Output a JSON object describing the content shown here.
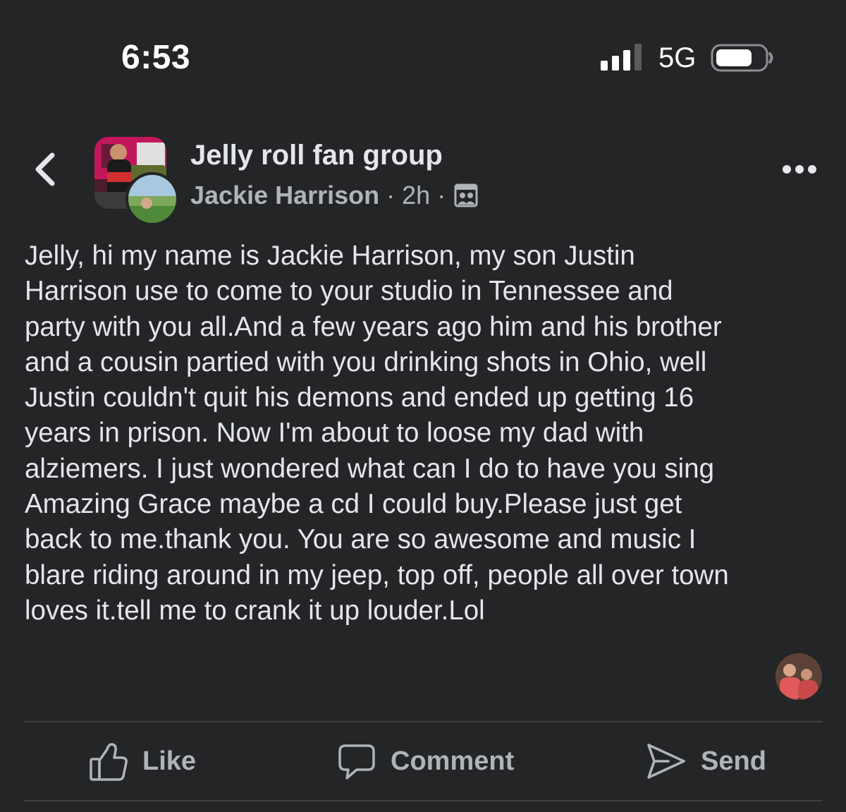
{
  "status_bar": {
    "time": "6:53",
    "network": "5G",
    "signal_level": 3,
    "signal_max": 4
  },
  "header": {
    "back_icon": "chevron-left-icon",
    "group_name": "Jelly roll fan group",
    "author": "Jackie Harrison",
    "separator": "·",
    "time_ago": "2h",
    "privacy_icon": "group-members-icon",
    "more_icon": "more-horizontal-icon"
  },
  "post": {
    "text": "Jelly, hi my name is Jackie Harrison, my son Justin\nHarrison use to come to your studio in Tennessee and\nparty with you all.And a few years ago him and his brother\nand a cousin partied with you drinking shots in Ohio, well\nJustin couldn't quit his demons and ended up getting 16\nyears in prison. Now I'm about to loose my dad with\nalziemers. I just wondered what can I do to have you sing\nAmazing Grace maybe a cd I could buy.Please just get\nback to me.thank you. You are so awesome and music I\nblare riding around in my jeep, top off, people all over town\nloves it.tell me to crank it up louder.Lol"
  },
  "actions": {
    "like_label": "Like",
    "comment_label": "Comment",
    "send_label": "Send"
  },
  "colors": {
    "background": "#242526",
    "text_primary": "#e4e6eb",
    "text_secondary": "#b0b3b8",
    "divider": "#3e4042"
  }
}
